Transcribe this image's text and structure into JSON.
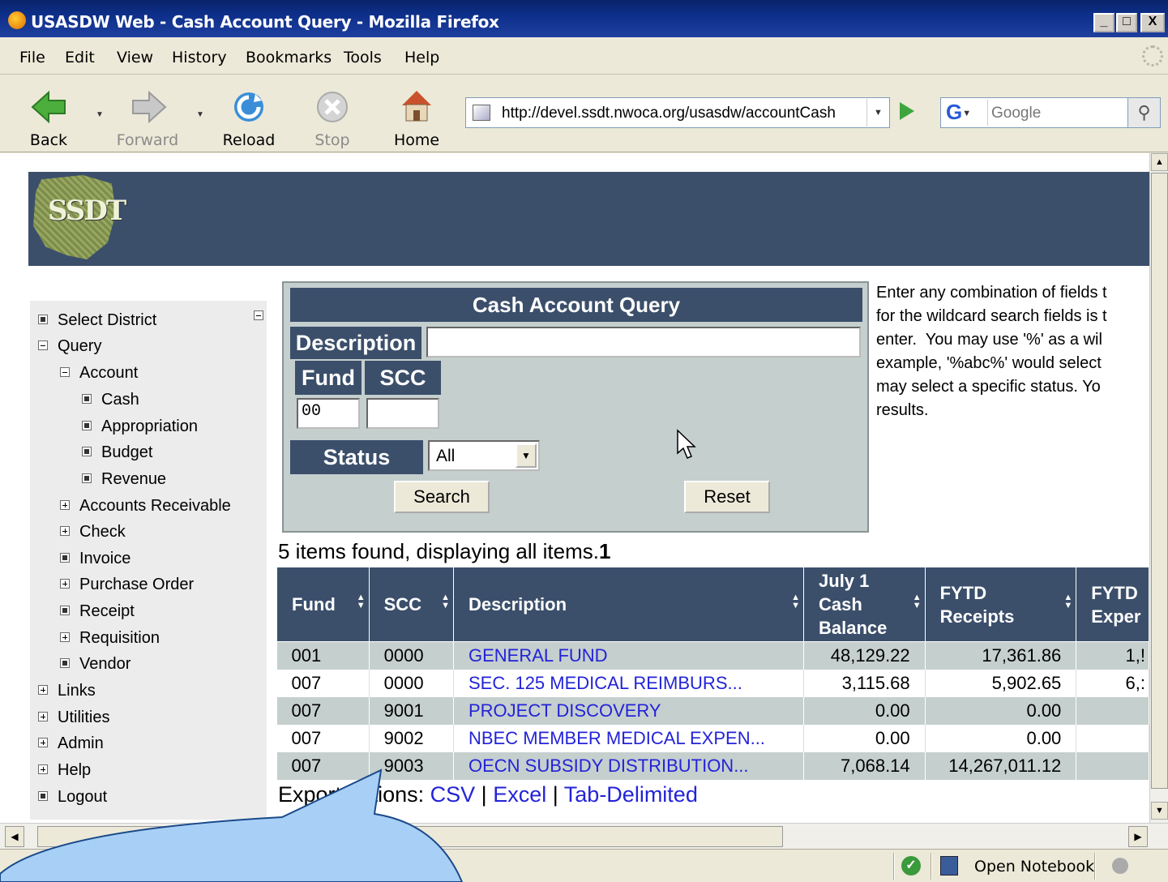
{
  "window": {
    "title": "USASDW Web - Cash Account Query - Mozilla Firefox",
    "controls": [
      "_",
      "□",
      "X"
    ]
  },
  "menu": [
    "File",
    "Edit",
    "View",
    "History",
    "Bookmarks",
    "Tools",
    "Help"
  ],
  "toolbar": {
    "back": "Back",
    "forward": "Forward",
    "reload": "Reload",
    "stop": "Stop",
    "home": "Home",
    "url": "http://devel.ssdt.nwoca.org/usasdw/accountCash",
    "search_engine": "G",
    "search_placeholder": "Google"
  },
  "header": {
    "logo_text": "SSDT"
  },
  "sidebar": {
    "items": [
      {
        "label": "Select District",
        "state": "leaf",
        "level": 0
      },
      {
        "label": "Query",
        "state": "expanded",
        "level": 0
      },
      {
        "label": "Account",
        "state": "expanded",
        "level": 1
      },
      {
        "label": "Cash",
        "state": "leaf",
        "level": 2
      },
      {
        "label": "Appropriation",
        "state": "leaf",
        "level": 2
      },
      {
        "label": "Budget",
        "state": "leaf",
        "level": 2
      },
      {
        "label": "Revenue",
        "state": "leaf",
        "level": 2
      },
      {
        "label": "Accounts Receivable",
        "state": "collapsed",
        "level": 1
      },
      {
        "label": "Check",
        "state": "collapsed",
        "level": 1
      },
      {
        "label": "Invoice",
        "state": "leaf",
        "level": 1
      },
      {
        "label": "Purchase Order",
        "state": "collapsed",
        "level": 1
      },
      {
        "label": "Receipt",
        "state": "leaf",
        "level": 1
      },
      {
        "label": "Requisition",
        "state": "collapsed",
        "level": 1
      },
      {
        "label": "Vendor",
        "state": "leaf",
        "level": 1
      },
      {
        "label": "Links",
        "state": "collapsed",
        "level": 0
      },
      {
        "label": "Utilities",
        "state": "collapsed",
        "level": 0
      },
      {
        "label": "Admin",
        "state": "collapsed",
        "level": 0
      },
      {
        "label": "Help",
        "state": "collapsed",
        "level": 0
      },
      {
        "label": "Logout",
        "state": "leaf",
        "level": 0
      }
    ]
  },
  "query": {
    "title": "Cash Account Query",
    "description_label": "Description",
    "description_value": "",
    "fund_label": "Fund",
    "fund_value": "00",
    "scc_label": "SCC",
    "scc_value": "",
    "status_label": "Status",
    "status_value": "All",
    "search_button": "Search",
    "reset_button": "Reset"
  },
  "help": {
    "lines": [
      "Enter any combination of fields t",
      "for the wildcard search fields is t",
      "enter.  You may use '%' as a wil",
      "example, '%abc%' would select",
      "may select a specific status. Yo",
      "results."
    ]
  },
  "results": {
    "summary": "5 items found, displaying all items.",
    "page": "1",
    "columns": [
      "Fund",
      "SCC",
      "Description",
      "July 1 Cash Balance",
      "FYTD Receipts",
      "FYTD Exper"
    ],
    "rows": [
      [
        "001",
        "0000",
        "GENERAL FUND",
        "48,129.22",
        "17,361.86",
        "1,!"
      ],
      [
        "007",
        "0000",
        "SEC. 125 MEDICAL REIMBURS...",
        "3,115.68",
        "5,902.65",
        "6,:"
      ],
      [
        "007",
        "9001",
        "PROJECT DISCOVERY",
        "0.00",
        "0.00",
        ""
      ],
      [
        "007",
        "9002",
        "NBEC MEMBER MEDICAL EXPEN...",
        "0.00",
        "0.00",
        ""
      ],
      [
        "007",
        "9003",
        "OECN SUBSIDY DISTRIBUTION...",
        "7,068.14",
        "14,267,011.12",
        ""
      ]
    ]
  },
  "export": {
    "label": "Export options:",
    "csv": "CSV",
    "excel": "Excel",
    "tab": "Tab-Delimited",
    "sep": "|"
  },
  "statusbar": {
    "notebook": "Open Notebook"
  },
  "colors": {
    "header_navy": "#3b4f6b",
    "form_gray": "#c5cfce",
    "link_blue": "#2323d8",
    "bubble_blue": "#a8cff5"
  }
}
